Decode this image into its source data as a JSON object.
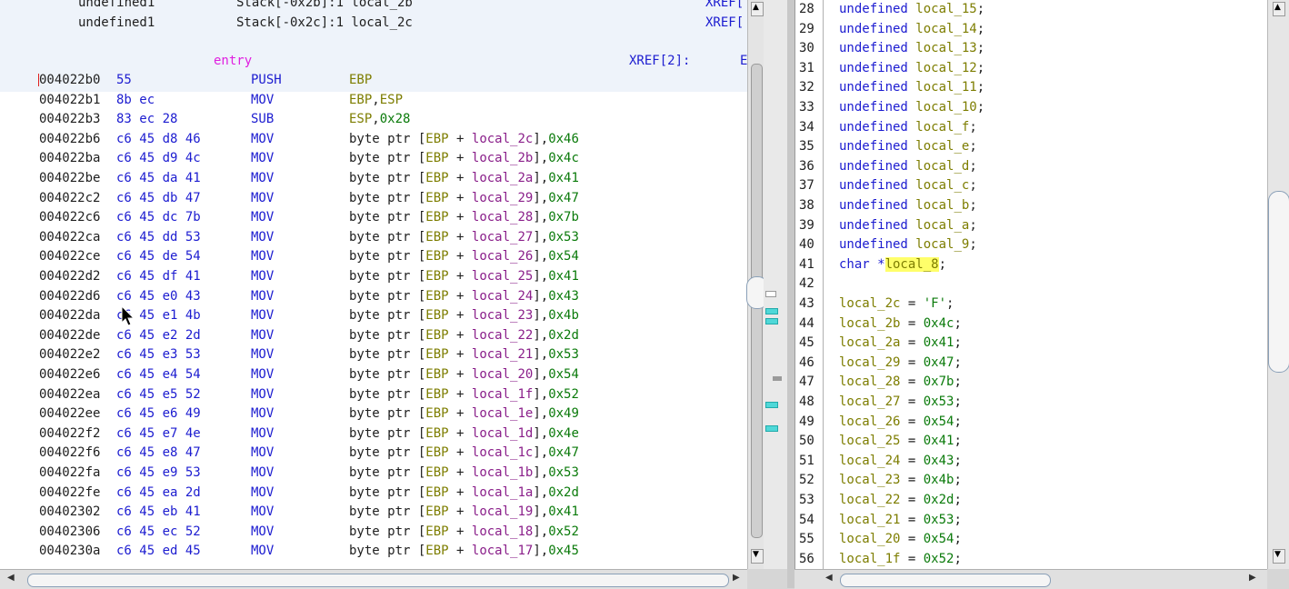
{
  "listing": {
    "header_rows": [
      {
        "type": "undefined1",
        "stack": "Stack[-0x2b]:1 local_2b",
        "xref": "XREF["
      },
      {
        "type": "undefined1",
        "stack": "Stack[-0x2c]:1 local_2c",
        "xref": "XREF["
      }
    ],
    "entry_label": "entry",
    "entry_xref": "XREF[2]:",
    "entry_xref_extra": "E",
    "rows": [
      {
        "addr": "004022b0",
        "bytes": "55",
        "mnemonic": "PUSH",
        "op": [
          [
            "reg",
            "EBP"
          ]
        ]
      },
      {
        "addr": "004022b1",
        "bytes": "8b ec",
        "mnemonic": "MOV",
        "op": [
          [
            "reg",
            "EBP"
          ],
          [
            "plain",
            ","
          ],
          [
            "reg",
            "ESP"
          ]
        ]
      },
      {
        "addr": "004022b3",
        "bytes": "83 ec 28",
        "mnemonic": "SUB",
        "op": [
          [
            "reg",
            "ESP"
          ],
          [
            "plain",
            ","
          ],
          [
            "num",
            "0x28"
          ]
        ]
      },
      {
        "addr": "004022b6",
        "bytes": "c6 45 d8 46",
        "mnemonic": "MOV",
        "var": "local_2c",
        "val": "0x46"
      },
      {
        "addr": "004022ba",
        "bytes": "c6 45 d9 4c",
        "mnemonic": "MOV",
        "var": "local_2b",
        "val": "0x4c"
      },
      {
        "addr": "004022be",
        "bytes": "c6 45 da 41",
        "mnemonic": "MOV",
        "var": "local_2a",
        "val": "0x41"
      },
      {
        "addr": "004022c2",
        "bytes": "c6 45 db 47",
        "mnemonic": "MOV",
        "var": "local_29",
        "val": "0x47"
      },
      {
        "addr": "004022c6",
        "bytes": "c6 45 dc 7b",
        "mnemonic": "MOV",
        "var": "local_28",
        "val": "0x7b"
      },
      {
        "addr": "004022ca",
        "bytes": "c6 45 dd 53",
        "mnemonic": "MOV",
        "var": "local_27",
        "val": "0x53"
      },
      {
        "addr": "004022ce",
        "bytes": "c6 45 de 54",
        "mnemonic": "MOV",
        "var": "local_26",
        "val": "0x54"
      },
      {
        "addr": "004022d2",
        "bytes": "c6 45 df 41",
        "mnemonic": "MOV",
        "var": "local_25",
        "val": "0x41"
      },
      {
        "addr": "004022d6",
        "bytes": "c6 45 e0 43",
        "mnemonic": "MOV",
        "var": "local_24",
        "val": "0x43"
      },
      {
        "addr": "004022da",
        "bytes": "c6 45 e1 4b",
        "mnemonic": "MOV",
        "var": "local_23",
        "val": "0x4b"
      },
      {
        "addr": "004022de",
        "bytes": "c6 45 e2 2d",
        "mnemonic": "MOV",
        "var": "local_22",
        "val": "0x2d"
      },
      {
        "addr": "004022e2",
        "bytes": "c6 45 e3 53",
        "mnemonic": "MOV",
        "var": "local_21",
        "val": "0x53"
      },
      {
        "addr": "004022e6",
        "bytes": "c6 45 e4 54",
        "mnemonic": "MOV",
        "var": "local_20",
        "val": "0x54"
      },
      {
        "addr": "004022ea",
        "bytes": "c6 45 e5 52",
        "mnemonic": "MOV",
        "var": "local_1f",
        "val": "0x52"
      },
      {
        "addr": "004022ee",
        "bytes": "c6 45 e6 49",
        "mnemonic": "MOV",
        "var": "local_1e",
        "val": "0x49"
      },
      {
        "addr": "004022f2",
        "bytes": "c6 45 e7 4e",
        "mnemonic": "MOV",
        "var": "local_1d",
        "val": "0x4e"
      },
      {
        "addr": "004022f6",
        "bytes": "c6 45 e8 47",
        "mnemonic": "MOV",
        "var": "local_1c",
        "val": "0x47"
      },
      {
        "addr": "004022fa",
        "bytes": "c6 45 e9 53",
        "mnemonic": "MOV",
        "var": "local_1b",
        "val": "0x53"
      },
      {
        "addr": "004022fe",
        "bytes": "c6 45 ea 2d",
        "mnemonic": "MOV",
        "var": "local_1a",
        "val": "0x2d"
      },
      {
        "addr": "00402302",
        "bytes": "c6 45 eb 41",
        "mnemonic": "MOV",
        "var": "local_19",
        "val": "0x41"
      },
      {
        "addr": "00402306",
        "bytes": "c6 45 ec 52",
        "mnemonic": "MOV",
        "var": "local_18",
        "val": "0x52"
      },
      {
        "addr": "0040230a",
        "bytes": "c6 45 ed 45",
        "mnemonic": "MOV",
        "var": "local_17",
        "val": "0x45"
      }
    ],
    "operand_prefix": "byte ptr [",
    "operand_reg": "EBP",
    "operand_plus": " + ",
    "operand_suffix": "],"
  },
  "decompiler": {
    "lines": [
      {
        "n": "28",
        "decl": [
          "undefined",
          "local_15"
        ]
      },
      {
        "n": "29",
        "decl": [
          "undefined",
          "local_14"
        ]
      },
      {
        "n": "30",
        "decl": [
          "undefined",
          "local_13"
        ]
      },
      {
        "n": "31",
        "decl": [
          "undefined",
          "local_12"
        ]
      },
      {
        "n": "32",
        "decl": [
          "undefined",
          "local_11"
        ]
      },
      {
        "n": "33",
        "decl": [
          "undefined",
          "local_10"
        ]
      },
      {
        "n": "34",
        "decl": [
          "undefined",
          "local_f"
        ]
      },
      {
        "n": "35",
        "decl": [
          "undefined",
          "local_e"
        ]
      },
      {
        "n": "36",
        "decl": [
          "undefined",
          "local_d"
        ]
      },
      {
        "n": "37",
        "decl": [
          "undefined",
          "local_c"
        ]
      },
      {
        "n": "38",
        "decl": [
          "undefined",
          "local_b"
        ]
      },
      {
        "n": "39",
        "decl": [
          "undefined",
          "local_a"
        ]
      },
      {
        "n": "40",
        "decl": [
          "undefined",
          "local_9"
        ]
      },
      {
        "n": "41",
        "char": [
          "char *",
          "local_8"
        ]
      },
      {
        "n": "42"
      },
      {
        "n": "43",
        "assign": [
          "local_2c",
          "'F'"
        ]
      },
      {
        "n": "44",
        "assign": [
          "local_2b",
          "0x4c"
        ]
      },
      {
        "n": "45",
        "assign": [
          "local_2a",
          "0x41"
        ]
      },
      {
        "n": "46",
        "assign": [
          "local_29",
          "0x47"
        ]
      },
      {
        "n": "47",
        "assign": [
          "local_28",
          "0x7b"
        ]
      },
      {
        "n": "48",
        "assign": [
          "local_27",
          "0x53"
        ]
      },
      {
        "n": "49",
        "assign": [
          "local_26",
          "0x54"
        ]
      },
      {
        "n": "50",
        "assign": [
          "local_25",
          "0x41"
        ]
      },
      {
        "n": "51",
        "assign": [
          "local_24",
          "0x43"
        ]
      },
      {
        "n": "52",
        "assign": [
          "local_23",
          "0x4b"
        ]
      },
      {
        "n": "53",
        "assign": [
          "local_22",
          "0x2d"
        ]
      },
      {
        "n": "54",
        "assign": [
          "local_21",
          "0x53"
        ]
      },
      {
        "n": "55",
        "assign": [
          "local_20",
          "0x54"
        ]
      },
      {
        "n": "56",
        "assign": [
          "local_1f",
          "0x52"
        ]
      }
    ]
  },
  "colors": {
    "keyword": "#1c1cd0",
    "variable": "#7d7d00",
    "number": "#0a7a0a",
    "local_var": "#8a1f8a",
    "label": "#e020e0",
    "highlight": "#ffff6a"
  }
}
